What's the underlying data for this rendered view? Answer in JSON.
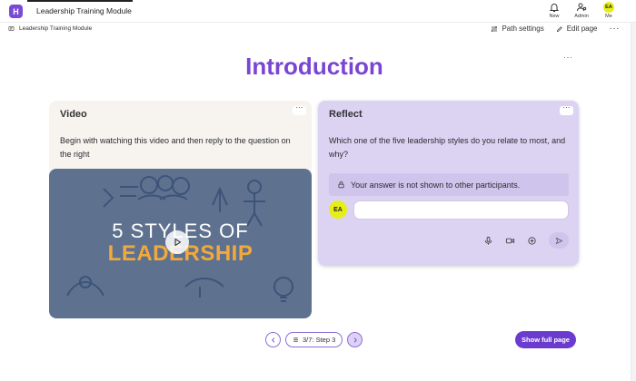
{
  "app": {
    "logo_letter": "H",
    "title": "Leadership Training Module"
  },
  "top_actions": [
    {
      "icon": "bell-icon",
      "label": "New"
    },
    {
      "icon": "admin-icon",
      "label": "Admin"
    },
    {
      "icon": "avatar",
      "label": "Me",
      "initials": "EA"
    }
  ],
  "breadcrumb": {
    "label": "Leadership Training Module"
  },
  "page_tools": {
    "path_settings": "Path settings",
    "edit_page": "Edit page"
  },
  "page": {
    "heading": "Introduction"
  },
  "video_card": {
    "title": "Video",
    "text": "Begin with watching this video and then reply to the question on the right",
    "thumbnail_line1": "5 STYLES OF",
    "thumbnail_line2": "LEADERSHIP"
  },
  "reflect_card": {
    "title": "Reflect",
    "question": "Which one of the five leadership styles do you relate to most, and why?",
    "notice": "Your answer is not shown to other participants.",
    "avatar_initials": "EA",
    "answer_value": "",
    "answer_placeholder": ""
  },
  "pager": {
    "step_label": "3/7: Step 3"
  },
  "show_full_page": "Show full page",
  "colors": {
    "brand": "#7a45d3",
    "button": "#6b3bcf",
    "reflect_bg": "#dcd3f3",
    "avatar": "#e6ee1a"
  }
}
